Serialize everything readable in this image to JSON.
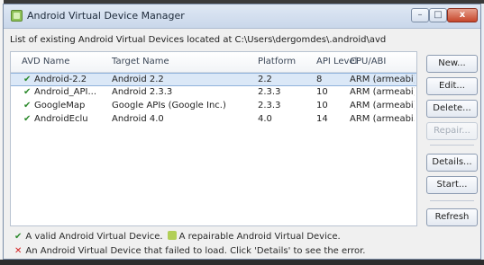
{
  "window": {
    "title": "Android Virtual Device Manager",
    "controls": {
      "minimize": "–",
      "maximize": "□",
      "close": "x"
    }
  },
  "path_label": "List of existing Android Virtual Devices located at C:\\Users\\dergomdes\\.android\\avd",
  "table": {
    "columns": [
      "AVD Name",
      "Target Name",
      "Platform",
      "API Level",
      "CPU/ABI"
    ],
    "rows": [
      {
        "name": "Android-2.2",
        "target": "Android 2.2",
        "platform": "2.2",
        "api": "8",
        "cpu": "ARM (armeabi)",
        "selected": true
      },
      {
        "name": "Android_API...",
        "target": "Android 2.3.3",
        "platform": "2.3.3",
        "api": "10",
        "cpu": "ARM (armeabi)",
        "selected": false
      },
      {
        "name": "GoogleMap",
        "target": "Google APIs (Google Inc.)",
        "platform": "2.3.3",
        "api": "10",
        "cpu": "ARM (armeabi)",
        "selected": false
      },
      {
        "name": "AndroidEclu",
        "target": "Android 4.0",
        "platform": "4.0",
        "api": "14",
        "cpu": "ARM (armeabi...",
        "selected": false
      }
    ]
  },
  "buttons": {
    "new": "New...",
    "edit": "Edit...",
    "delete": "Delete...",
    "repair": "Repair...",
    "details": "Details...",
    "start": "Start...",
    "refresh": "Refresh"
  },
  "legend": {
    "valid": "A valid Android Virtual Device.",
    "repairable": "A repairable Android Virtual Device.",
    "failed": "An Android Virtual Device that failed to load. Click 'Details' to see the error."
  },
  "colors": {
    "valid_check": "#2e8b2e",
    "error_x": "#d32222",
    "selection": "#dbe8f7"
  },
  "icons": {
    "valid": "check-icon",
    "repairable": "repair-icon",
    "failed": "error-x-icon"
  }
}
